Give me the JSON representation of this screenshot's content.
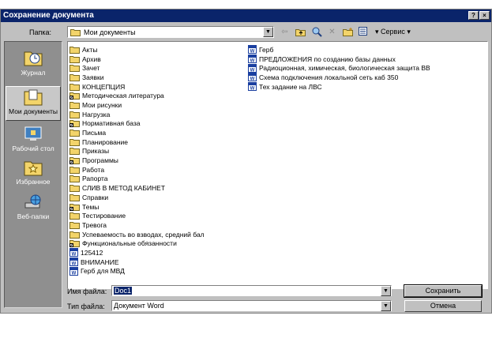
{
  "window": {
    "title": "Сохранение документа",
    "help_btn": "?",
    "close_btn": "×"
  },
  "lookin": {
    "label": "Папка:",
    "value": "Мои документы"
  },
  "toolbar": {
    "service_label": "Сервис"
  },
  "places": [
    {
      "label": "Журнал",
      "icon": "history-icon"
    },
    {
      "label": "Мои документы",
      "icon": "my-documents-icon",
      "selected": true
    },
    {
      "label": "Рабочий стол",
      "icon": "desktop-icon"
    },
    {
      "label": "Избранное",
      "icon": "favorites-icon"
    },
    {
      "label": "Веб-папки",
      "icon": "web-folders-icon"
    }
  ],
  "files_col1": [
    {
      "name": "Акты",
      "icon": "folder-icon"
    },
    {
      "name": "Архив",
      "icon": "folder-icon"
    },
    {
      "name": "Зачет",
      "icon": "folder-icon"
    },
    {
      "name": "Заявки",
      "icon": "folder-icon"
    },
    {
      "name": "КОНЦЕПЦИЯ",
      "icon": "folder-icon"
    },
    {
      "name": "Методическая литература",
      "icon": "shortcut-folder-icon"
    },
    {
      "name": "Мои рисунки",
      "icon": "folder-icon"
    },
    {
      "name": "Нагрузка",
      "icon": "folder-icon"
    },
    {
      "name": "Нормативная база",
      "icon": "shortcut-folder-icon"
    },
    {
      "name": "Письма",
      "icon": "folder-icon"
    },
    {
      "name": "Планирование",
      "icon": "folder-icon"
    },
    {
      "name": "Приказы",
      "icon": "folder-icon"
    },
    {
      "name": "Программы",
      "icon": "shortcut-folder-icon"
    },
    {
      "name": "Работа",
      "icon": "folder-icon"
    },
    {
      "name": "Рапорта",
      "icon": "folder-icon"
    },
    {
      "name": "СЛИВ В МЕТОД КАБИНЕТ",
      "icon": "folder-icon"
    },
    {
      "name": "Справки",
      "icon": "folder-icon"
    },
    {
      "name": "Темы",
      "icon": "shortcut-folder-icon"
    },
    {
      "name": "Тестирование",
      "icon": "folder-icon"
    },
    {
      "name": "Тревога",
      "icon": "folder-icon"
    },
    {
      "name": "Успеваемость во взводах, средний бал",
      "icon": "folder-icon"
    },
    {
      "name": "Функциональные обязанности",
      "icon": "shortcut-folder-icon"
    },
    {
      "name": "125412",
      "icon": "word-doc-icon"
    },
    {
      "name": "ВНИМАНИЕ",
      "icon": "word-doc-icon"
    },
    {
      "name": "Герб для МВД",
      "icon": "word-doc-icon"
    }
  ],
  "files_col2": [
    {
      "name": "Герб",
      "icon": "word-doc-icon"
    },
    {
      "name": "ПРЕДЛОЖЕНИЯ по созданию базы данных",
      "icon": "word-doc-icon"
    },
    {
      "name": "Радиоционная, химическая, биологическая защита ВВ",
      "icon": "word-doc-icon"
    },
    {
      "name": "Схема подключения локальной сеть каб 350",
      "icon": "word-doc-icon"
    },
    {
      "name": "Тех задание на ЛВС",
      "icon": "word-doc-icon"
    }
  ],
  "filename": {
    "label": "Имя файла:",
    "value": "Doc1"
  },
  "filetype": {
    "label": "Тип файла:",
    "value": "Документ Word"
  },
  "buttons": {
    "save": "Сохранить",
    "cancel": "Отмена"
  },
  "colors": {
    "titlebar": "#0a246a",
    "dialog": "#c0c0c0",
    "places_bg": "#8f8f8f",
    "folder": "#f3d46a"
  }
}
